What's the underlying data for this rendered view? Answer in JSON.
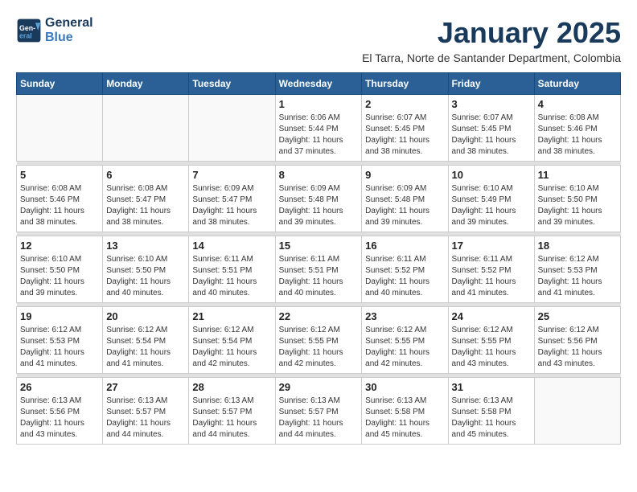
{
  "header": {
    "logo_line1": "General",
    "logo_line2": "Blue",
    "month_title": "January 2025",
    "subtitle": "El Tarra, Norte de Santander Department, Colombia"
  },
  "days_of_week": [
    "Sunday",
    "Monday",
    "Tuesday",
    "Wednesday",
    "Thursday",
    "Friday",
    "Saturday"
  ],
  "weeks": [
    [
      {
        "day": "",
        "info": ""
      },
      {
        "day": "",
        "info": ""
      },
      {
        "day": "",
        "info": ""
      },
      {
        "day": "1",
        "info": "Sunrise: 6:06 AM\nSunset: 5:44 PM\nDaylight: 11 hours and 37 minutes."
      },
      {
        "day": "2",
        "info": "Sunrise: 6:07 AM\nSunset: 5:45 PM\nDaylight: 11 hours and 38 minutes."
      },
      {
        "day": "3",
        "info": "Sunrise: 6:07 AM\nSunset: 5:45 PM\nDaylight: 11 hours and 38 minutes."
      },
      {
        "day": "4",
        "info": "Sunrise: 6:08 AM\nSunset: 5:46 PM\nDaylight: 11 hours and 38 minutes."
      }
    ],
    [
      {
        "day": "5",
        "info": "Sunrise: 6:08 AM\nSunset: 5:46 PM\nDaylight: 11 hours and 38 minutes."
      },
      {
        "day": "6",
        "info": "Sunrise: 6:08 AM\nSunset: 5:47 PM\nDaylight: 11 hours and 38 minutes."
      },
      {
        "day": "7",
        "info": "Sunrise: 6:09 AM\nSunset: 5:47 PM\nDaylight: 11 hours and 38 minutes."
      },
      {
        "day": "8",
        "info": "Sunrise: 6:09 AM\nSunset: 5:48 PM\nDaylight: 11 hours and 39 minutes."
      },
      {
        "day": "9",
        "info": "Sunrise: 6:09 AM\nSunset: 5:48 PM\nDaylight: 11 hours and 39 minutes."
      },
      {
        "day": "10",
        "info": "Sunrise: 6:10 AM\nSunset: 5:49 PM\nDaylight: 11 hours and 39 minutes."
      },
      {
        "day": "11",
        "info": "Sunrise: 6:10 AM\nSunset: 5:50 PM\nDaylight: 11 hours and 39 minutes."
      }
    ],
    [
      {
        "day": "12",
        "info": "Sunrise: 6:10 AM\nSunset: 5:50 PM\nDaylight: 11 hours and 39 minutes."
      },
      {
        "day": "13",
        "info": "Sunrise: 6:10 AM\nSunset: 5:50 PM\nDaylight: 11 hours and 40 minutes."
      },
      {
        "day": "14",
        "info": "Sunrise: 6:11 AM\nSunset: 5:51 PM\nDaylight: 11 hours and 40 minutes."
      },
      {
        "day": "15",
        "info": "Sunrise: 6:11 AM\nSunset: 5:51 PM\nDaylight: 11 hours and 40 minutes."
      },
      {
        "day": "16",
        "info": "Sunrise: 6:11 AM\nSunset: 5:52 PM\nDaylight: 11 hours and 40 minutes."
      },
      {
        "day": "17",
        "info": "Sunrise: 6:11 AM\nSunset: 5:52 PM\nDaylight: 11 hours and 41 minutes."
      },
      {
        "day": "18",
        "info": "Sunrise: 6:12 AM\nSunset: 5:53 PM\nDaylight: 11 hours and 41 minutes."
      }
    ],
    [
      {
        "day": "19",
        "info": "Sunrise: 6:12 AM\nSunset: 5:53 PM\nDaylight: 11 hours and 41 minutes."
      },
      {
        "day": "20",
        "info": "Sunrise: 6:12 AM\nSunset: 5:54 PM\nDaylight: 11 hours and 41 minutes."
      },
      {
        "day": "21",
        "info": "Sunrise: 6:12 AM\nSunset: 5:54 PM\nDaylight: 11 hours and 42 minutes."
      },
      {
        "day": "22",
        "info": "Sunrise: 6:12 AM\nSunset: 5:55 PM\nDaylight: 11 hours and 42 minutes."
      },
      {
        "day": "23",
        "info": "Sunrise: 6:12 AM\nSunset: 5:55 PM\nDaylight: 11 hours and 42 minutes."
      },
      {
        "day": "24",
        "info": "Sunrise: 6:12 AM\nSunset: 5:55 PM\nDaylight: 11 hours and 43 minutes."
      },
      {
        "day": "25",
        "info": "Sunrise: 6:12 AM\nSunset: 5:56 PM\nDaylight: 11 hours and 43 minutes."
      }
    ],
    [
      {
        "day": "26",
        "info": "Sunrise: 6:13 AM\nSunset: 5:56 PM\nDaylight: 11 hours and 43 minutes."
      },
      {
        "day": "27",
        "info": "Sunrise: 6:13 AM\nSunset: 5:57 PM\nDaylight: 11 hours and 44 minutes."
      },
      {
        "day": "28",
        "info": "Sunrise: 6:13 AM\nSunset: 5:57 PM\nDaylight: 11 hours and 44 minutes."
      },
      {
        "day": "29",
        "info": "Sunrise: 6:13 AM\nSunset: 5:57 PM\nDaylight: 11 hours and 44 minutes."
      },
      {
        "day": "30",
        "info": "Sunrise: 6:13 AM\nSunset: 5:58 PM\nDaylight: 11 hours and 45 minutes."
      },
      {
        "day": "31",
        "info": "Sunrise: 6:13 AM\nSunset: 5:58 PM\nDaylight: 11 hours and 45 minutes."
      },
      {
        "day": "",
        "info": ""
      }
    ]
  ]
}
